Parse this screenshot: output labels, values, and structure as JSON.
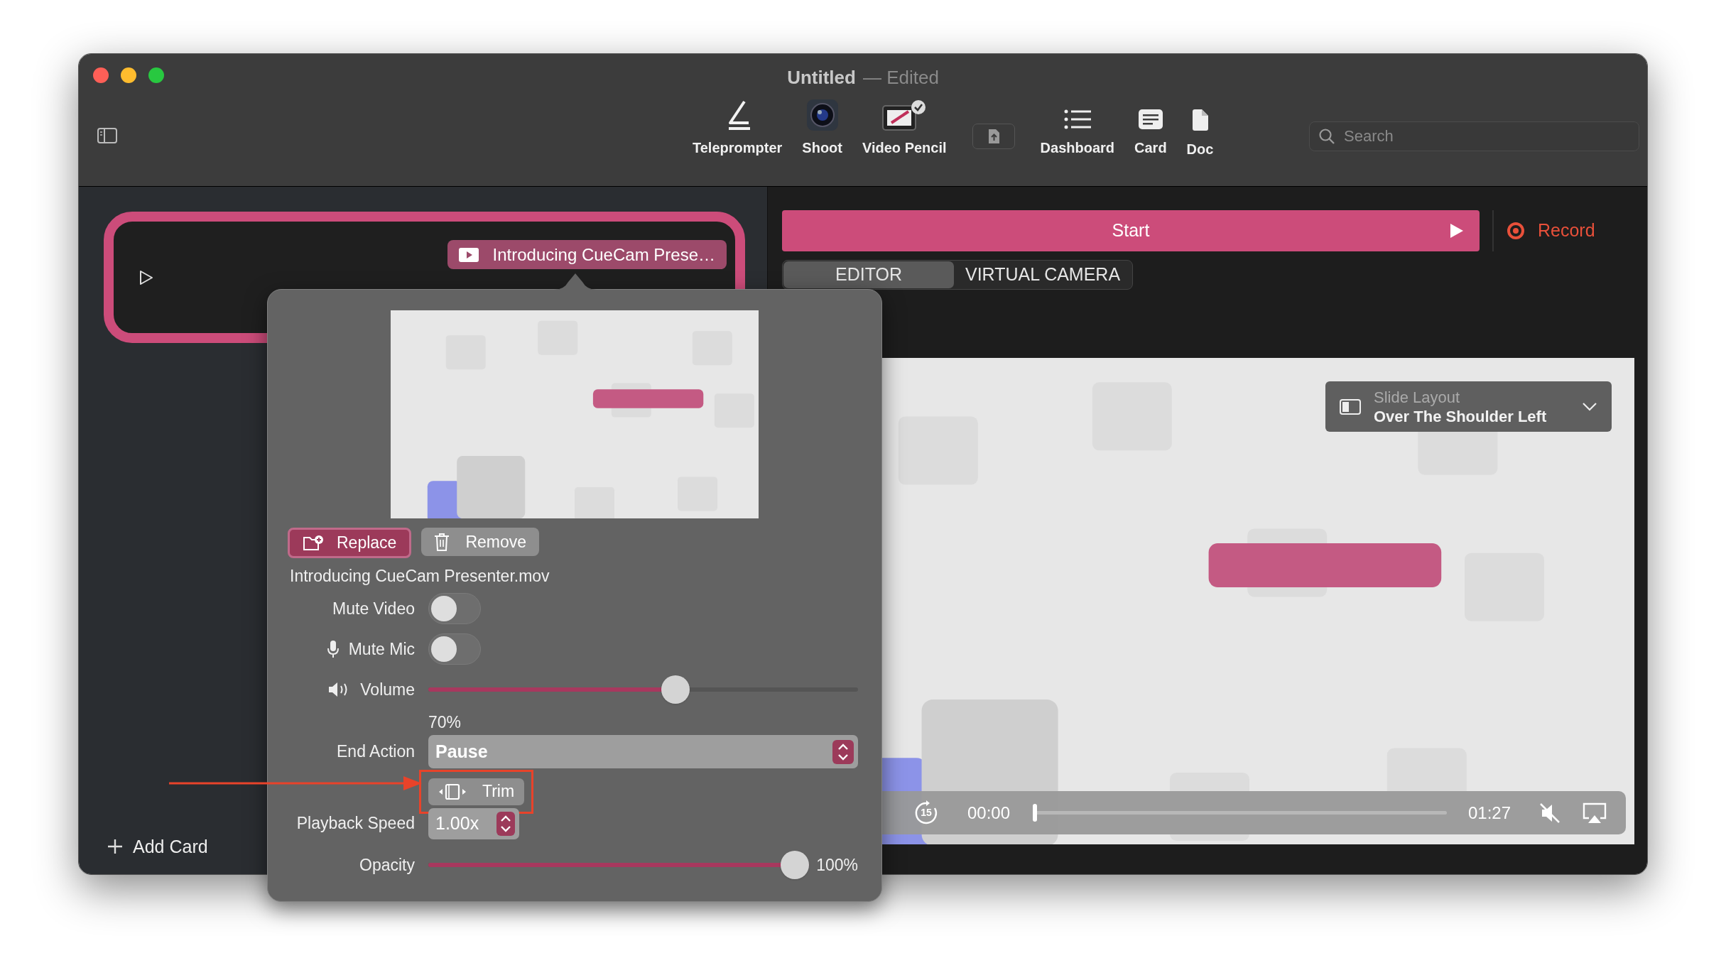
{
  "window": {
    "title": "Untitled",
    "edited_label": "— Edited"
  },
  "toolbar": {
    "items": [
      {
        "kind": "teleprompter",
        "label": "Teleprompter"
      },
      {
        "kind": "shoot",
        "label": "Shoot"
      },
      {
        "kind": "video_pencil",
        "label": "Video Pencil"
      },
      {
        "kind": "share"
      },
      {
        "kind": "dashboard",
        "label": "Dashboard"
      },
      {
        "kind": "card",
        "label": "Card"
      },
      {
        "kind": "doc",
        "label": "Doc"
      }
    ],
    "search": {
      "placeholder": "Search"
    }
  },
  "sidebar": {
    "card": {
      "selected": true,
      "media_tag": "Introducing CueCam Prese…"
    },
    "add_card": "Add Card"
  },
  "main": {
    "start": "Start",
    "record": "Record",
    "tabs": [
      {
        "label": "EDITOR",
        "selected": true
      },
      {
        "label": "VIRTUAL CAMERA",
        "selected": false
      }
    ],
    "slide_layout": {
      "label": "Slide Layout",
      "value": "Over The Shoulder Left"
    },
    "player": {
      "skip": "15",
      "current": "00:00",
      "duration": "01:27",
      "level": 0
    }
  },
  "popover": {
    "replace": "Replace",
    "remove": "Remove",
    "filename": "Introducing CueCam Presenter.mov",
    "rows": [
      {
        "kind": "toggle",
        "label": "Mute Video",
        "on": false
      },
      {
        "kind": "toggle",
        "label": "Mute Mic",
        "on": false
      },
      {
        "kind": "slider",
        "label": "Volume",
        "level": 0.58,
        "reading": "70%"
      },
      {
        "kind": "popup",
        "label": "End Action",
        "value": "Pause"
      },
      {
        "kind": "button",
        "label": "Trim",
        "highlighted": true
      },
      {
        "kind": "stepper",
        "label": "Playback Speed",
        "value": "1.00x"
      },
      {
        "kind": "slider_inline",
        "label": "Opacity",
        "level": 1,
        "reading": "100%"
      }
    ]
  }
}
